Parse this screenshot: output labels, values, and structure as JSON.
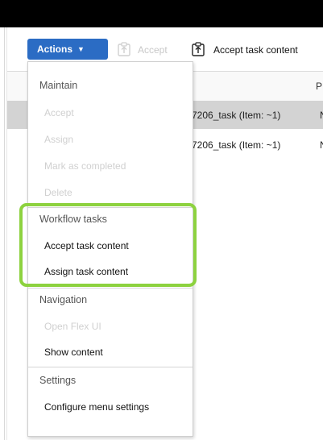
{
  "toolbar": {
    "actions_label": "Actions",
    "accept_label": "Accept",
    "accept_task_content_label": "Accept task content"
  },
  "grid": {
    "header_col_partial": "P",
    "rows": [
      {
        "name": "7206_task (Item: ~1)",
        "col2": "N",
        "selected": true
      },
      {
        "name": "7206_task (Item: ~1)",
        "col2": "N",
        "selected": false
      }
    ]
  },
  "menu": {
    "maintain": {
      "header": "Maintain",
      "items": [
        "Accept",
        "Assign",
        "Mark as completed",
        "Delete"
      ]
    },
    "workflow": {
      "header": "Workflow tasks",
      "items": [
        "Accept task content",
        "Assign task content"
      ]
    },
    "navigation": {
      "header": "Navigation",
      "items": [
        "Open Flex UI",
        "Show content"
      ]
    },
    "settings": {
      "header": "Settings",
      "items": [
        "Configure menu settings"
      ]
    }
  },
  "colors": {
    "accent": "#2b6cc4",
    "highlight": "#8dd23f",
    "row_selected": "#d3d3d3",
    "disabled_text": "#d0d0d0"
  },
  "icons": {
    "accept": "clipboard-arrow-icon",
    "accept_task_content": "clipboard-arrow-icon",
    "caret": "caret-down-icon"
  }
}
